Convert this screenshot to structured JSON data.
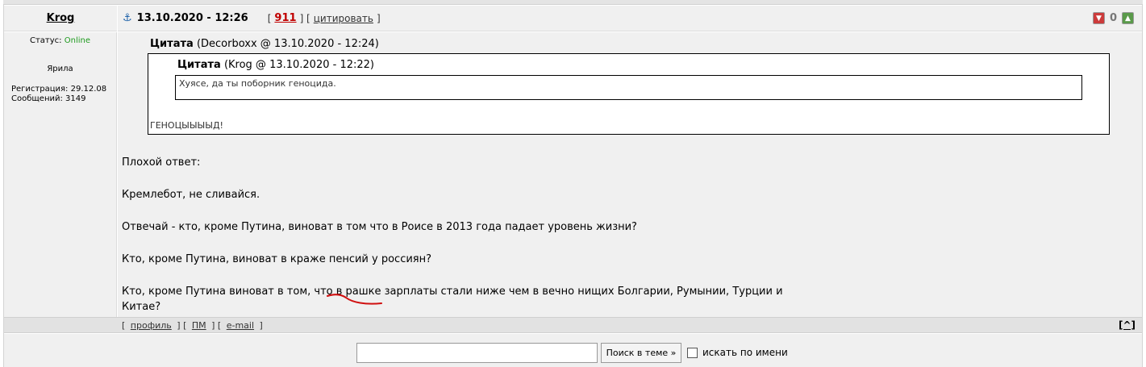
{
  "post": {
    "author": "Krog",
    "date": "13.10.2020 - 12:26",
    "rep_open": "[",
    "rep_value": "911",
    "rep_sep": "] [",
    "quote_label": "цитировать",
    "rep_close": "]",
    "votes": {
      "count": "0"
    },
    "user": {
      "status_label": "Статус:",
      "status_value": "Online",
      "rank": "Ярила",
      "reg": "Регистрация: 29.12.08",
      "posts": "Сообщений: 3149"
    },
    "quote_outer": {
      "label": "Цитата",
      "meta": "(Decorboxx @ 13.10.2020 - 12:24)",
      "text": "ГЕНОЦЫЫЫЫД!"
    },
    "quote_inner": {
      "label": "Цитата",
      "meta": "(Krog @ 13.10.2020 - 12:22)",
      "text": "Хуясе, да ты поборник геноцида."
    },
    "paragraphs": [
      "Плохой ответ:",
      "Кремлебот, не сливайся.",
      "Отвечай - кто, кроме Путина, виноват в том что в Роисе в 2013 года падает уровень жизни?",
      "Кто, кроме Путина, виноват в краже пенсий у россиян?",
      "Кто, кроме Путина виноват в том, что в рашке зарплаты стали ниже чем в вечно нищих Болгарии, Румынии, Турции и Китае?"
    ]
  },
  "footer": {
    "b1": "[",
    "profile": "профиль",
    "b2": "] [",
    "pm": "ПМ",
    "b3": "] [",
    "email": "e-mail",
    "b4": "]",
    "top": "[^]"
  },
  "search": {
    "button": "Поиск в теме »",
    "checkbox_label": "искать по имени"
  },
  "colors": {
    "accent_red": "#c00000",
    "online": "#1e9a1e",
    "panel": "#f0f0f0"
  }
}
